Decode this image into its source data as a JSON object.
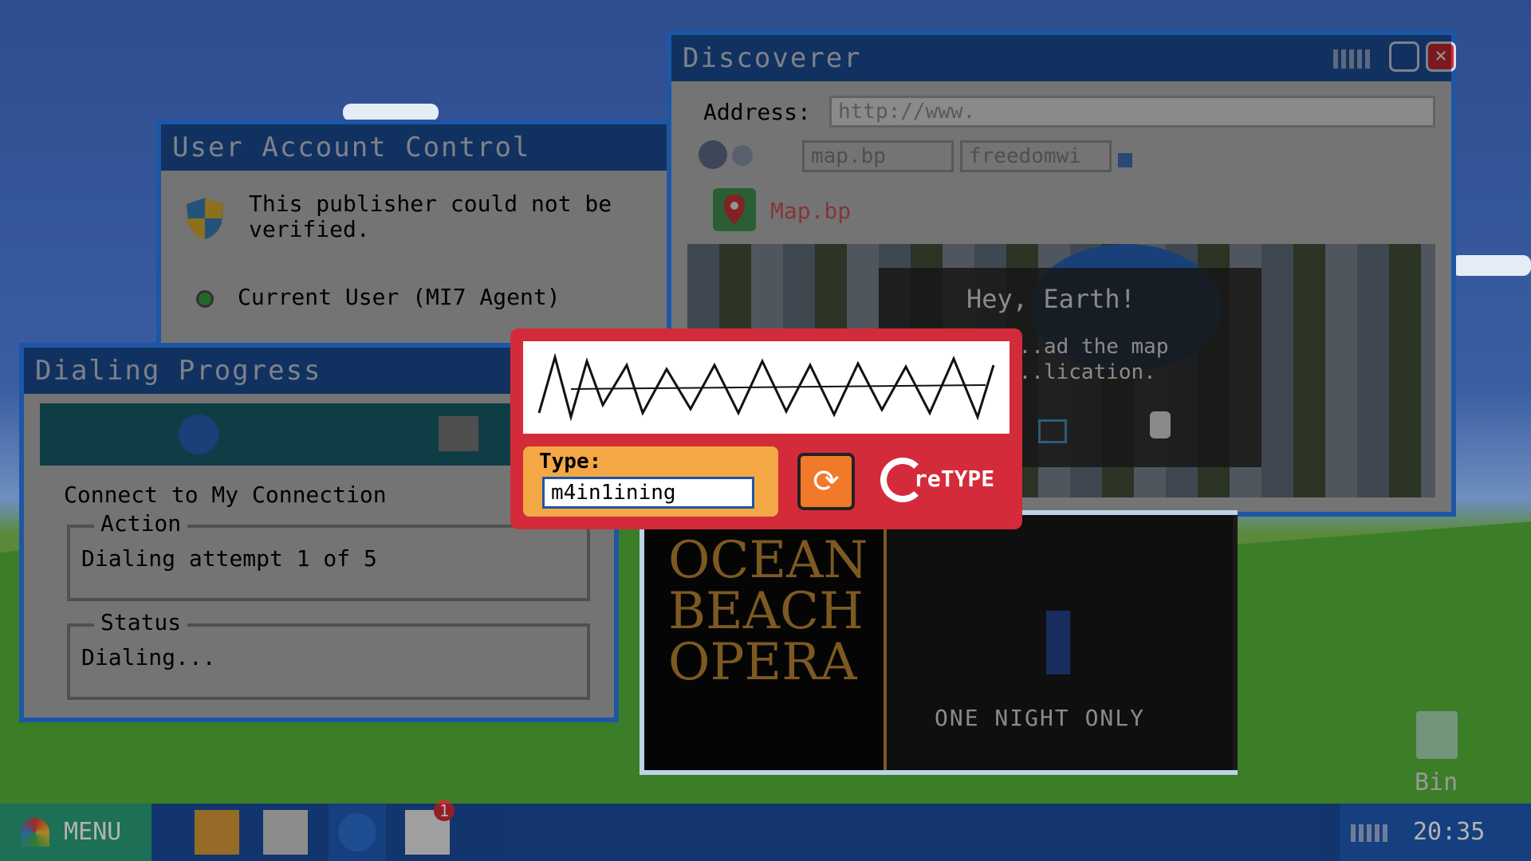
{
  "uac": {
    "title": "User Account Control",
    "message": "This publisher could not be verified.",
    "user": "Current User (MI7 Agent)"
  },
  "dialing": {
    "title": "Dialing Progress",
    "connect_text": "Connect to My Connection",
    "action_legend": "Action",
    "action_text": "Dialing attempt 1 of 5",
    "status_legend": "Status",
    "status_text": "Dialing..."
  },
  "discoverer": {
    "title": "Discoverer",
    "address_label": "Address:",
    "address_value": "http://www.",
    "tabs": [
      "map.bp",
      "freedomwi"
    ],
    "map_title": "Map.bp",
    "popup_title": "Hey, Earth!",
    "popup_line1": "...ad the map",
    "popup_line2": "...lication."
  },
  "opera": {
    "line1": "OCEAN",
    "line2": "BEACH",
    "line3": "OPERA",
    "subtitle": "ONE NIGHT ONLY"
  },
  "captcha": {
    "type_label": "Type:",
    "input_value": "m4in1ining",
    "retype_label": "reTYPE"
  },
  "taskbar": {
    "menu_label": "MENU",
    "mail_badge": "1",
    "clock": "20:35"
  },
  "desktop": {
    "bin_label": "Bin"
  },
  "colors": {
    "window_blue": "#1e56a6",
    "captcha_red": "#d42b3a",
    "captcha_orange": "#f3a845"
  }
}
